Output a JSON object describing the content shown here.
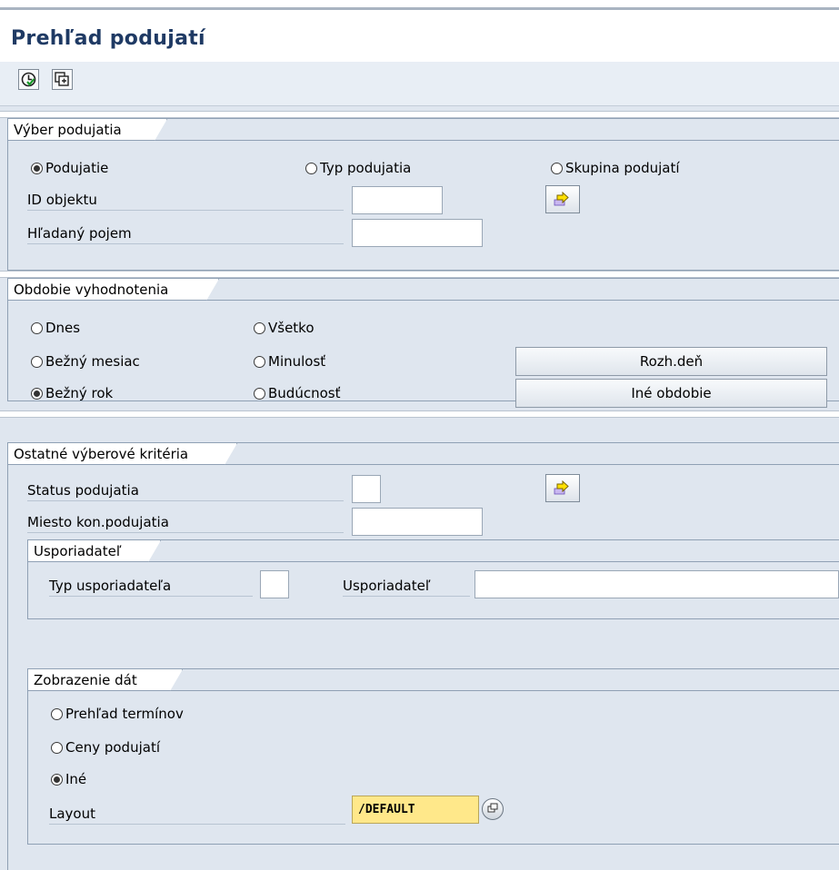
{
  "page": {
    "title": "Prehľad podujatí"
  },
  "toolbar": {
    "execute_icon": "execute-icon",
    "copy_icon": "copy-variant-icon"
  },
  "selection": {
    "title": "Výber podujatia",
    "radios": [
      {
        "label": "Podujatie",
        "selected": true
      },
      {
        "label": "Typ podujatia",
        "selected": false
      },
      {
        "label": "Skupina podujatí",
        "selected": false
      }
    ],
    "id_label": "ID objektu",
    "id_value": "",
    "search_label": "Hľadaný pojem",
    "search_value": ""
  },
  "period": {
    "title": "Obdobie vyhodnotenia",
    "radios": [
      {
        "label": "Dnes",
        "selected": false
      },
      {
        "label": "Všetko",
        "selected": false
      },
      {
        "label": "Bežný mesiac",
        "selected": false
      },
      {
        "label": "Minulosť",
        "selected": false
      },
      {
        "label": "Bežný rok",
        "selected": true
      },
      {
        "label": "Budúcnosť",
        "selected": false
      }
    ],
    "btn_key_date": "Rozh.deň",
    "btn_other_period": "Iné obdobie"
  },
  "other": {
    "title": "Ostatné výberové kritéria",
    "status_label": "Status podujatia",
    "status_value": "",
    "location_label": "Miesto kon.podujatia",
    "location_value": "",
    "organizer": {
      "title": "Usporiadateľ",
      "type_label": "Typ usporiadateľa",
      "type_value": "",
      "org_label": "Usporiadateľ",
      "org_value": ""
    },
    "display": {
      "title": "Zobrazenie dát",
      "radios": [
        {
          "label": "Prehľad termínov",
          "selected": false
        },
        {
          "label": "Ceny podujatí",
          "selected": false
        },
        {
          "label": "Iné",
          "selected": true
        }
      ],
      "layout_label": "Layout",
      "layout_value": "/DEFAULT"
    }
  }
}
